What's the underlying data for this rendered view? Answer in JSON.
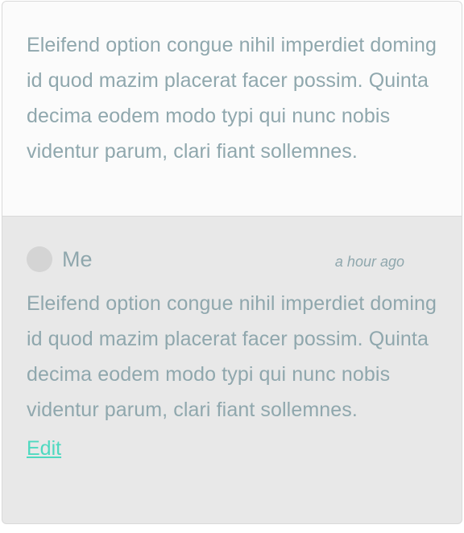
{
  "post": {
    "body": "Eleifend option congue nihil imperdiet doming id quod mazim placerat facer possim. Quinta decima eodem modo typi qui nunc nobis videntur parum, clari fiant sollemnes."
  },
  "comment": {
    "author": "Me",
    "timestamp": "a hour ago",
    "body": "Eleifend option congue nihil imperdiet doming id quod mazim placerat facer possim. Quinta decima eodem modo typi qui nunc nobis videntur parum, clari fiant sollemnes.",
    "edit_label": "Edit"
  },
  "colors": {
    "text": "#8fa7ad",
    "link": "#4fd9c0",
    "post_background": "#fbfbfb",
    "comment_background": "#e8e8e8"
  }
}
